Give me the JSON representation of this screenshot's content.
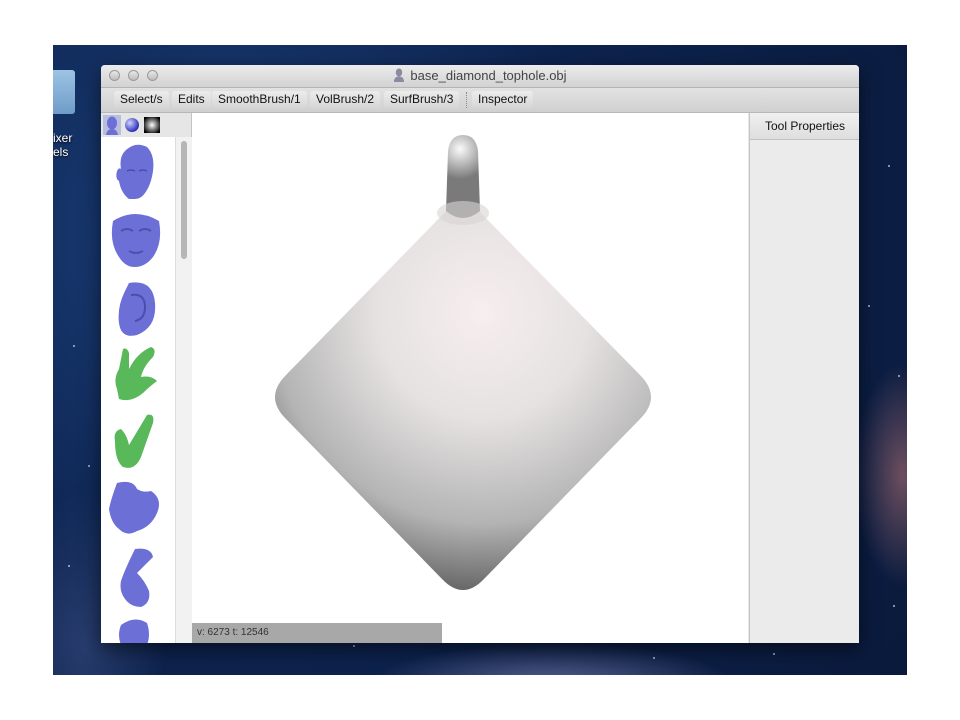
{
  "desktop": {
    "item_label_lines": [
      "ixer",
      "els"
    ]
  },
  "window": {
    "title": "base_diamond_tophole.obj",
    "title_icon": "bust-icon"
  },
  "toolbar": {
    "items": [
      "Select/s",
      "Edits",
      "SmoothBrush/1",
      "VolBrush/2",
      "SurfBrush/3",
      "Inspector"
    ]
  },
  "sidebar": {
    "tabs": [
      "head-icon",
      "sphere-icon",
      "gradient-square-icon"
    ],
    "thumbnails": [
      {
        "name": "head",
        "color": "#6b6fd6"
      },
      {
        "name": "face",
        "color": "#6b6fd6"
      },
      {
        "name": "ear",
        "color": "#6b6fd6"
      },
      {
        "name": "hand-open",
        "color": "#58b85a"
      },
      {
        "name": "hand-fist",
        "color": "#58b85a"
      },
      {
        "name": "foot",
        "color": "#6b6fd6"
      },
      {
        "name": "arm",
        "color": "#6b6fd6"
      },
      {
        "name": "partial",
        "color": "#6b6fd6"
      }
    ]
  },
  "viewport": {
    "model_name": "diamond-with-top-knob",
    "status": "v: 6273  t: 12546"
  },
  "right_panel": {
    "title": "Tool Properties"
  }
}
